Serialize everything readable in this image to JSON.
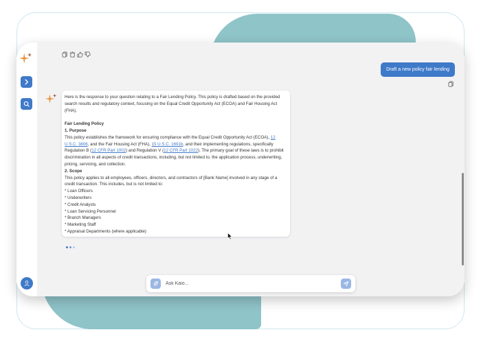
{
  "colors": {
    "accent": "#3f79c9",
    "accent_light": "#9bb7e4",
    "teal": "#8fc4c9",
    "window_bg": "#f2f2f3",
    "star_orange": "#e8943f",
    "star_dark": "#8c4a2c"
  },
  "toolbar": {
    "icons": [
      "copy-icon",
      "delete-icon",
      "thumbs-up-icon",
      "thumbs-down-icon"
    ]
  },
  "sidebar": {
    "logo": "sparkle-logo-icon",
    "buttons": [
      "expand-chevron-icon",
      "search-chat-icon"
    ],
    "avatar": "user-icon"
  },
  "conversation": {
    "user_message": "Draft a new policy fair lending",
    "assistant": {
      "intro": "Here is the response to your question relating to a Fair Lending Policy. This policy is drafted based on the provided search results and regulatory context, focusing on the Equal Credit Opportunity Act (ECOA) and Fair Housing Act (FHA).",
      "title": "Fair Lending Policy",
      "section1_heading": "1. Purpose",
      "purpose_a": "This policy establishes the framework for ensuring compliance with the Equal Credit Opportunity Act (ECOA), ",
      "link_ecoa": "12 U.S.C. 3806",
      "purpose_b": ", and the Fair Housing Act (FHA), ",
      "link_fha": "15 U.S.C. 1691b",
      "purpose_c": ", and their implementing regulations, specifically Regulation B (",
      "link_regb": "12 CFR Part 1002",
      "purpose_d": ") and Regulation V (",
      "link_regv": "12 CFR Part 1022",
      "purpose_e": "). The primary goal of these laws is to prohibit discrimination in all aspects of credit transactions, including, but not limited to, the application process, underwriting, pricing, servicing, and collection.",
      "section2_heading": "2. Scope",
      "scope_text": "This policy applies to all employees, officers, directors, and contractors of [Bank Name] involved in any stage of a credit transaction. This includes, but is not limited to:",
      "scope_items": [
        "* Loan Officers",
        "* Underwriters",
        "* Credit Analysts",
        "* Loan Servicing Personnel",
        "* Branch Managers",
        "* Marketing Staff",
        "* Appraisal Departments (where applicable)"
      ]
    }
  },
  "composer": {
    "placeholder": "Ask Kaio...",
    "attach_icon": "paperclip-icon",
    "send_icon": "send-icon"
  }
}
